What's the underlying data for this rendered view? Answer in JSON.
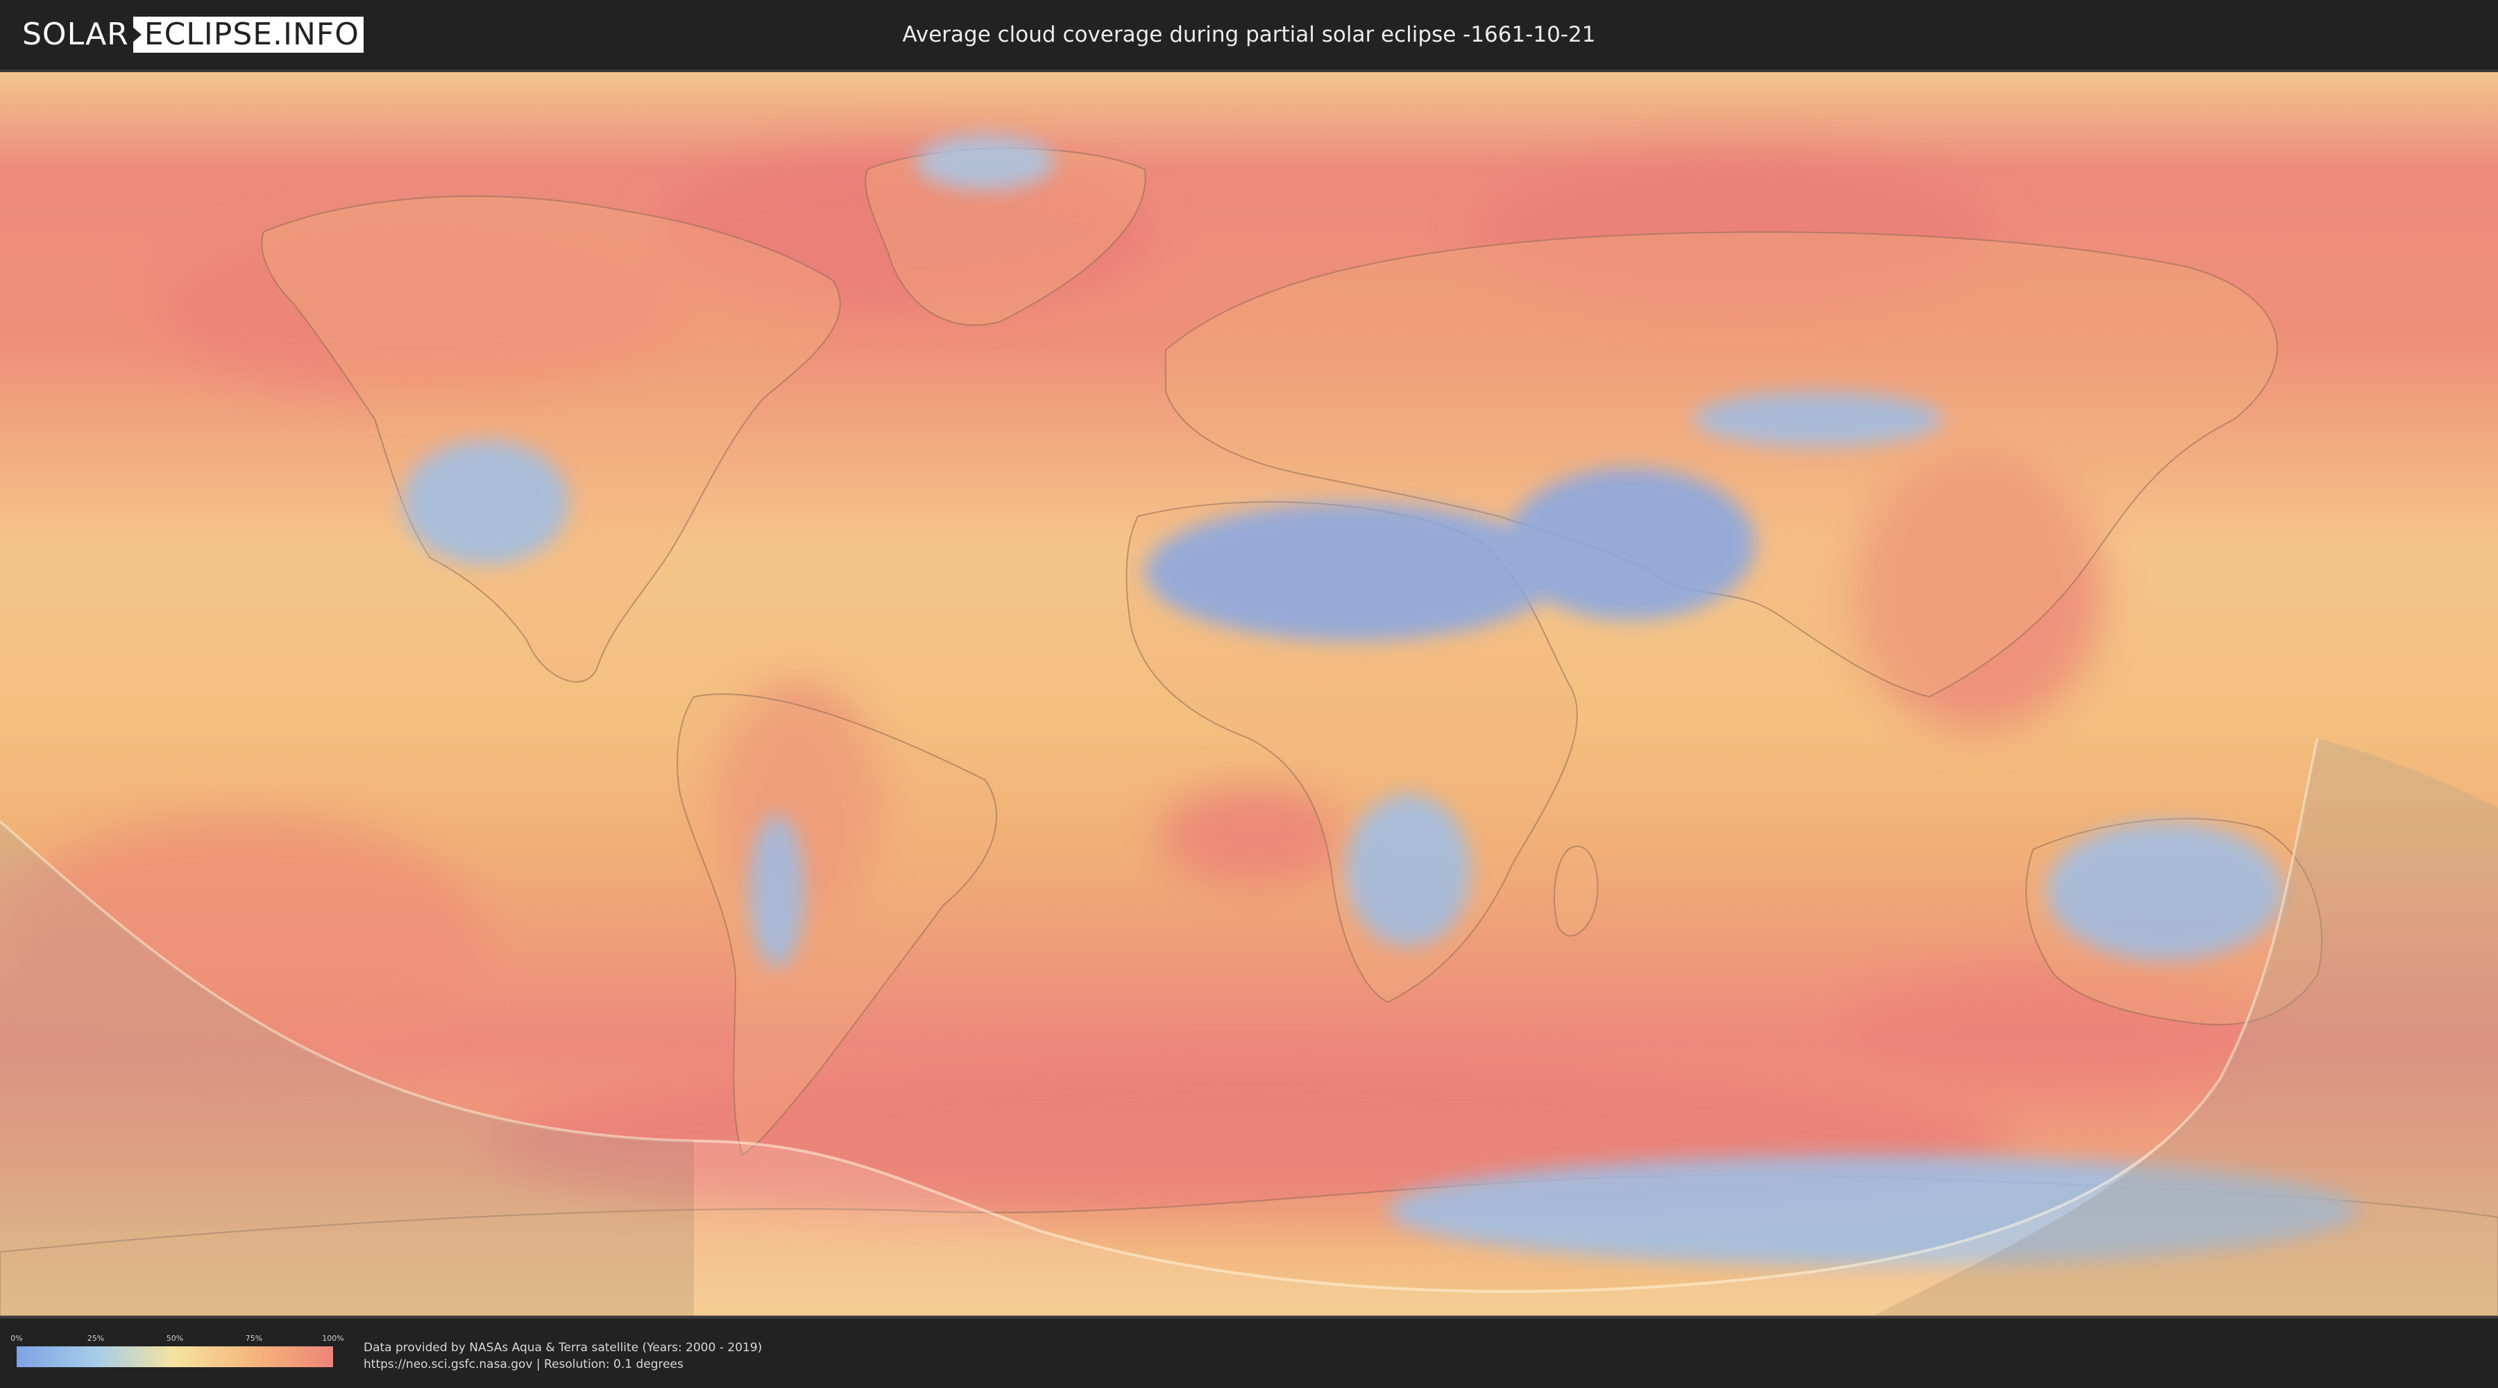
{
  "header": {
    "logo_left": "SOLAR",
    "logo_right": "ECLIPSE.INFO",
    "title": "Average cloud coverage during partial solar eclipse -1661-10-21"
  },
  "map": {
    "land_color": "#f2b070",
    "clear_sky_color": "#7ea3e6",
    "cloudy_color": "#ee8479",
    "eclipse_overlay_color": "#ffffff"
  },
  "legend": {
    "ticks": [
      "0%",
      "25%",
      "50%",
      "75%",
      "100%"
    ],
    "gradient": [
      "#7ea3e6",
      "#a6cde8",
      "#f6e2a0",
      "#f6b67a",
      "#ee8479"
    ]
  },
  "footer": {
    "line1": "Data provided by NASAs Aqua & Terra satellite (Years: 2000 - 2019)",
    "line2": "https://neo.sci.gsfc.nasa.gov | Resolution: 0.1 degrees"
  }
}
